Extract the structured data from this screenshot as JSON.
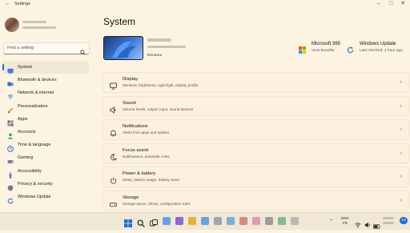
{
  "titlebar": {
    "back_icon": "back-arrow-icon",
    "title": "Settings",
    "controls": [
      "minimize",
      "maximize",
      "close"
    ]
  },
  "sidebar": {
    "search": {
      "placeholder": "Find a setting",
      "icon": "search-icon"
    },
    "items": [
      {
        "label": "System",
        "icon": "system-icon",
        "color": "#3b7dd8",
        "active": true
      },
      {
        "label": "Bluetooth & devices",
        "icon": "bluetooth-icon",
        "color": "#2b6ed0"
      },
      {
        "label": "Network & internet",
        "icon": "network-icon",
        "color": "#3b7dd8"
      },
      {
        "label": "Personalization",
        "icon": "brush-icon",
        "color": "#e08a3a"
      },
      {
        "label": "Apps",
        "icon": "apps-icon",
        "color": "#6a6a7a"
      },
      {
        "label": "Accounts",
        "icon": "accounts-icon",
        "color": "#2fa36b"
      },
      {
        "label": "Time & language",
        "icon": "globe-clock-icon",
        "color": "#2b6ed0"
      },
      {
        "label": "Gaming",
        "icon": "gaming-icon",
        "color": "#7a7a8a"
      },
      {
        "label": "Accessibility",
        "icon": "accessibility-icon",
        "color": "#2b6ed0"
      },
      {
        "label": "Privacy & security",
        "icon": "shield-icon",
        "color": "#7a7a8a"
      },
      {
        "label": "Windows Update",
        "icon": "update-icon",
        "color": "#2b6ed0"
      }
    ]
  },
  "main": {
    "title": "System",
    "device": {
      "rename_label": "Rename"
    },
    "promos": [
      {
        "title": "Microsoft 365",
        "subtitle": "View benefits",
        "icon": "microsoft-logo-icon"
      },
      {
        "title": "Windows Update",
        "subtitle": "Last checked: 1 hour ago",
        "icon": "update-icon"
      }
    ],
    "cards": [
      {
        "title": "Display",
        "subtitle": "Monitors, brightness, night light, display profile",
        "icon": "display-icon"
      },
      {
        "title": "Sound",
        "subtitle": "Volume levels, output, input, sound devices",
        "icon": "speaker-icon"
      },
      {
        "title": "Notifications",
        "subtitle": "Alerts from apps and system",
        "icon": "bell-icon"
      },
      {
        "title": "Focus assist",
        "subtitle": "Notifications, automatic rules",
        "icon": "moon-icon"
      },
      {
        "title": "Power & battery",
        "subtitle": "Sleep, battery usage, battery saver",
        "icon": "power-icon"
      },
      {
        "title": "Storage",
        "subtitle": "Storage space, drives, configuration rules",
        "icon": "storage-icon"
      }
    ]
  },
  "taskbar": {
    "lang_line1": "ENG",
    "lang_line2": "FR",
    "notification_count": "13"
  }
}
